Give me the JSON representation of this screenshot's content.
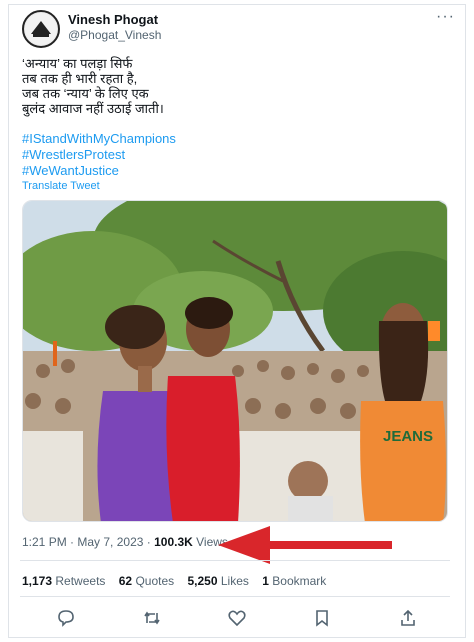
{
  "author": {
    "name": "Vinesh Phogat",
    "handle": "@Phogat_Vinesh"
  },
  "tweet": {
    "lines": [
      "‘अन्याय’ का पलड़ा सिर्फ",
      "तब तक ही भारी रहता है,",
      "जब तक ‘न्याय’ के लिए एक",
      "बुलंद आवाज नहीं उठाई जाती।"
    ],
    "hashtags": [
      "#IStandWithMyChampions",
      "#WrestlersProtest",
      "#WeWantJustice"
    ],
    "translate_label": "Translate Tweet"
  },
  "meta": {
    "time": "1:21 PM",
    "sep": " · ",
    "date": "May 7, 2023",
    "views_count": "100.3K",
    "views_label": "Views"
  },
  "stats": {
    "retweets_count": "1,173",
    "retweets_label": "Retweets",
    "quotes_count": "62",
    "quotes_label": "Quotes",
    "likes_count": "5,250",
    "likes_label": "Likes",
    "bookmarks_count": "1",
    "bookmarks_label": "Bookmark"
  },
  "photo": {
    "shirt_text": "JEANS"
  },
  "icons": {
    "more": "more-icon",
    "reply": "reply-icon",
    "retweet": "retweet-icon",
    "like": "like-icon",
    "bookmark": "bookmark-icon",
    "share": "share-icon"
  },
  "colors": {
    "link": "#1d9bf0",
    "muted": "#536471",
    "arrow": "#d9262b"
  }
}
